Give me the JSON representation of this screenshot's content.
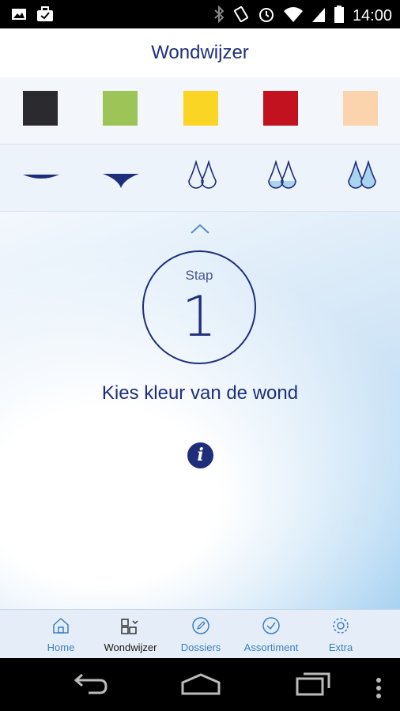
{
  "status_bar": {
    "time": "14:00",
    "left_icons": [
      "image-icon",
      "briefcase-icon"
    ],
    "right_icons": [
      "bluetooth-icon",
      "vibrate-icon",
      "alarm-icon",
      "wifi-icon",
      "signal-icon",
      "battery-icon"
    ]
  },
  "app_bar": {
    "title": "Wondwijzer"
  },
  "wound_colors": [
    "#2b2a2e",
    "#9dc456",
    "#fbd523",
    "#c2121f",
    "#fbd3ad"
  ],
  "exudate_levels": [
    "none",
    "low",
    "moderate",
    "high",
    "very-high"
  ],
  "step": {
    "label": "Stap",
    "number": "1",
    "instruction": "Kies kleur van de wond"
  },
  "tabs": [
    {
      "label": "Home",
      "icon": "home-icon",
      "active": false
    },
    {
      "label": "Wondwijzer",
      "icon": "wondwijzer-icon",
      "active": true
    },
    {
      "label": "Dossiers",
      "icon": "pencil-icon",
      "active": false
    },
    {
      "label": "Assortiment",
      "icon": "check-icon",
      "active": false
    },
    {
      "label": "Extra",
      "icon": "gear-icon",
      "active": false
    }
  ],
  "colors": {
    "accent": "#1f2e7a",
    "tab_inactive": "#3d7fc0"
  }
}
